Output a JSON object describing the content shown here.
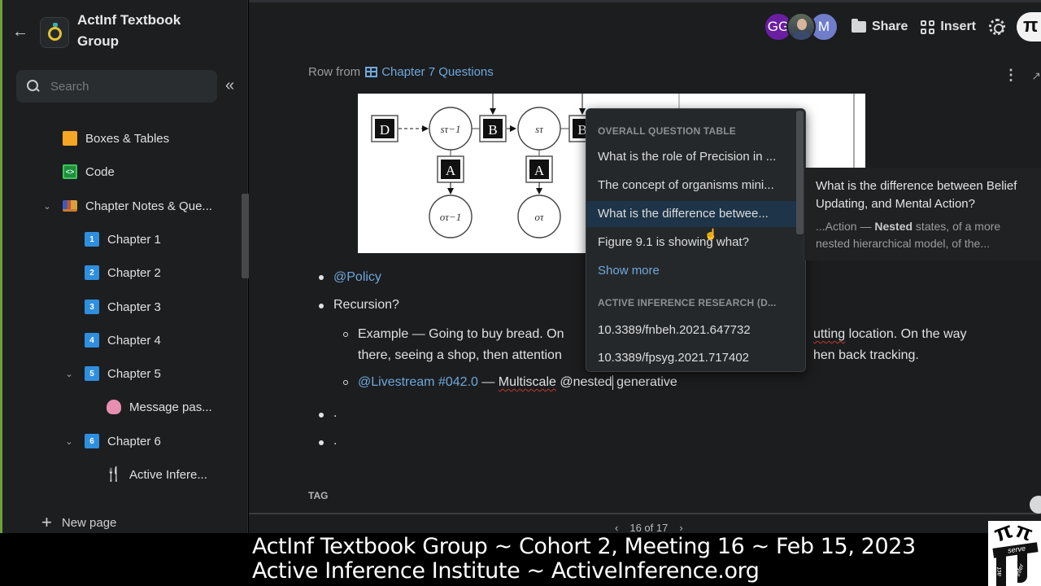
{
  "workspace": {
    "title": "ActInf Textbook Group",
    "back_icon": "arrow-left-icon",
    "logo_icon": "ring-icon"
  },
  "sidebar": {
    "search_placeholder": "Search",
    "collapse_icon": "double-chevron-left-icon",
    "items": [
      {
        "label": "Boxes & Tables",
        "icon": "orange-square-icon",
        "level": 1
      },
      {
        "label": "Code",
        "icon": "computer-code-icon",
        "level": 1
      },
      {
        "label": "Chapter Notes & Que...",
        "icon": "books-icon",
        "level": 1,
        "expanded": true
      },
      {
        "label": "Chapter 1",
        "icon": "1",
        "level": 2
      },
      {
        "label": "Chapter 2",
        "icon": "2",
        "level": 2
      },
      {
        "label": "Chapter 3",
        "icon": "3",
        "level": 2
      },
      {
        "label": "Chapter 4",
        "icon": "4",
        "level": 2
      },
      {
        "label": "Chapter 5",
        "icon": "5",
        "level": 2,
        "expanded": true
      },
      {
        "label": "Message pas...",
        "icon": "brain-icon",
        "level": 3
      },
      {
        "label": "Chapter 6",
        "icon": "6",
        "level": 2,
        "expanded": true
      },
      {
        "label": "Active Infere...",
        "icon": "fork-knife-icon",
        "level": 3
      }
    ],
    "new_page_label": "New page"
  },
  "topbar": {
    "avatars": [
      "GG",
      "",
      "M"
    ],
    "share_label": "Share",
    "insert_label": "Insert",
    "settings_icon": "gear-icon"
  },
  "page": {
    "row_from_label": "Row from",
    "row_from_link": "Chapter 7 Questions",
    "figure": {
      "nodes": [
        "D",
        "B",
        "B",
        "A",
        "A"
      ],
      "state_labels": [
        "sτ−1",
        "sτ"
      ],
      "obs_labels": [
        "oτ−1",
        "oτ"
      ]
    },
    "bullets": [
      {
        "text": "@Policy",
        "mention": true
      },
      {
        "text": "Recursion?"
      },
      {
        "sub": true,
        "line1": "Example — Going to buy bread. On",
        "line1_tail": "utting location. On the way",
        "line2": "there, seeing a shop, then attention",
        "line2_tail": "hen back tracking."
      },
      {
        "sub": true,
        "mention": "@Livestream #042.0",
        "dash": " — ",
        "misspelled": "Multiscale",
        "rest": " @nested",
        "after_caret": " generative"
      },
      {
        "text": "."
      },
      {
        "text": "."
      }
    ],
    "tag_label": "TAG",
    "pager": {
      "prev": "‹",
      "label": "16 of 17",
      "next": "›"
    }
  },
  "mention_popup": {
    "section1": "OVERALL QUESTION TABLE",
    "options1": [
      "What is the role of Precision in ...",
      "The concept of organisms mini...",
      "What is the difference betwee...",
      "Figure 9.1 is showing what?"
    ],
    "active_index": 2,
    "show_more": "Show more",
    "section2": "ACTIVE INFERENCE RESEARCH (D...",
    "options2": [
      "10.3389/fnbeh.2021.647732",
      "10.3389/fpsyg.2021.717402"
    ]
  },
  "preview": {
    "title": "What is the difference between Belief Updating, and Mental Action?",
    "snippet_pre": "...Action — ",
    "snippet_bold": "Nested",
    "snippet_post": " states, of a more nested hierarchical model, of the..."
  },
  "caption": {
    "line1": "ActInf Textbook Group ~ Cohort 2, Meeting 16 ~ Feb 15, 2023",
    "line2": "Active Inference Institute ~ ActiveInference.org",
    "logo_words": [
      "serve",
      "act",
      "infer"
    ]
  }
}
